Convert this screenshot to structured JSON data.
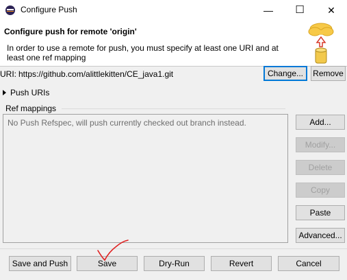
{
  "window": {
    "title": "Configure Push",
    "minimize": "—",
    "maximize": "☐",
    "close": "✕"
  },
  "banner": {
    "title": "Configure push for remote 'origin'",
    "description": "In order to use a remote for push, you must specify at least one URI and at least one ref mapping"
  },
  "uri": {
    "label": "URI:",
    "value": "https://github.com/alittlekitten/CE_java1.git",
    "change_label": "Change...",
    "remove_label": "Remove"
  },
  "push_uris": {
    "label": "Push URIs"
  },
  "ref_mappings": {
    "label": "Ref mappings",
    "empty_message": "No Push Refspec, will push currently checked out branch instead.",
    "buttons": {
      "add": "Add...",
      "modify": "Modify...",
      "delete": "Delete",
      "copy": "Copy",
      "paste": "Paste",
      "advanced": "Advanced..."
    }
  },
  "footer": {
    "save_and_push": "Save and Push",
    "save": "Save",
    "dry_run": "Dry-Run",
    "revert": "Revert",
    "cancel": "Cancel"
  },
  "colors": {
    "accent": "#0078d7",
    "annotation": "#e02020",
    "banner_cloud": "#f7c948",
    "banner_arrow": "#d83a2a"
  },
  "icons": {
    "app": "eclipse-icon",
    "banner": "push-to-cloud-icon",
    "disclosure": "triangle-right-icon"
  }
}
